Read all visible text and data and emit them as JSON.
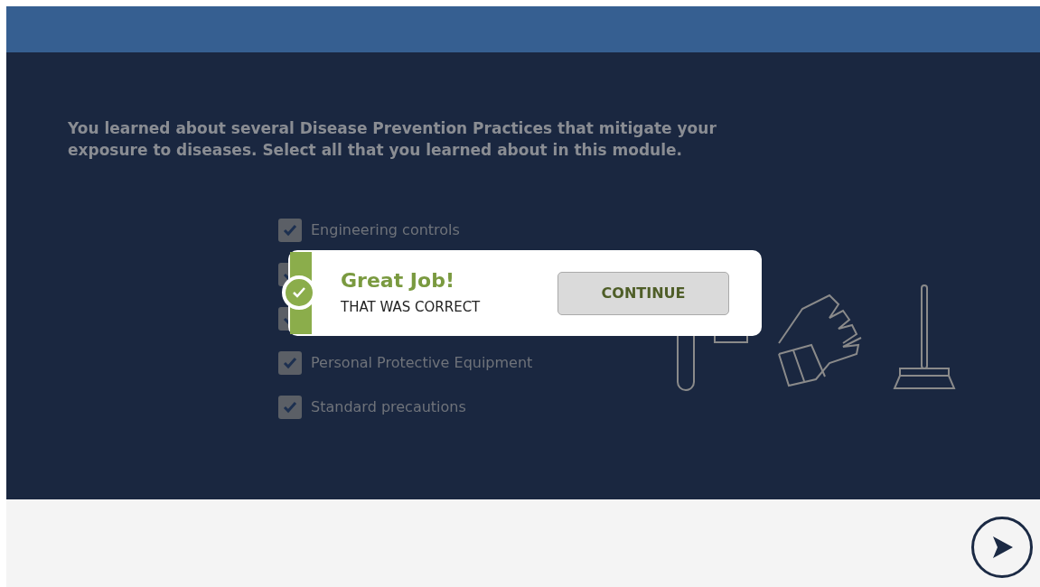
{
  "question": "You learned about several Disease Prevention Practices that mitigate your exposure to diseases. Select all that you learned about in this module.",
  "options": [
    {
      "label": "Engineering controls",
      "checked": true
    },
    {
      "checked": true
    },
    {
      "checked": true
    },
    {
      "label": "Personal Protective Equipment",
      "checked": true
    },
    {
      "label": "Standard precautions",
      "checked": true
    }
  ],
  "feedback": {
    "title": "Great Job!",
    "message": "THAT WAS CORRECT",
    "button": "CONTINUE",
    "correct": true
  }
}
